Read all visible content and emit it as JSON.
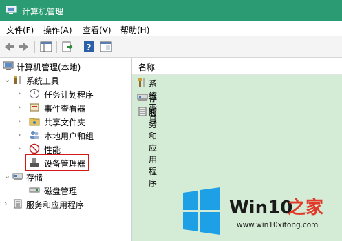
{
  "window": {
    "title": "计算机管理"
  },
  "menu": [
    "文件(F)",
    "操作(A)",
    "查看(V)",
    "帮助(H)"
  ],
  "tree": {
    "root": "计算机管理(本地)",
    "system_tools": "系统工具",
    "task_scheduler": "任务计划程序",
    "event_viewer": "事件查看器",
    "shared_folders": "共享文件夹",
    "local_users": "本地用户和组",
    "performance": "性能",
    "device_manager": "设备管理器",
    "storage": "存储",
    "disk_management": "磁盘管理",
    "services_apps": "服务和应用程序"
  },
  "list": {
    "column": "名称",
    "items": [
      "系统工具",
      "存储",
      "服务和应用程序"
    ]
  },
  "watermark": {
    "brand_a": "Win10",
    "brand_b": "之家",
    "url": "www.win10xitong.com"
  }
}
